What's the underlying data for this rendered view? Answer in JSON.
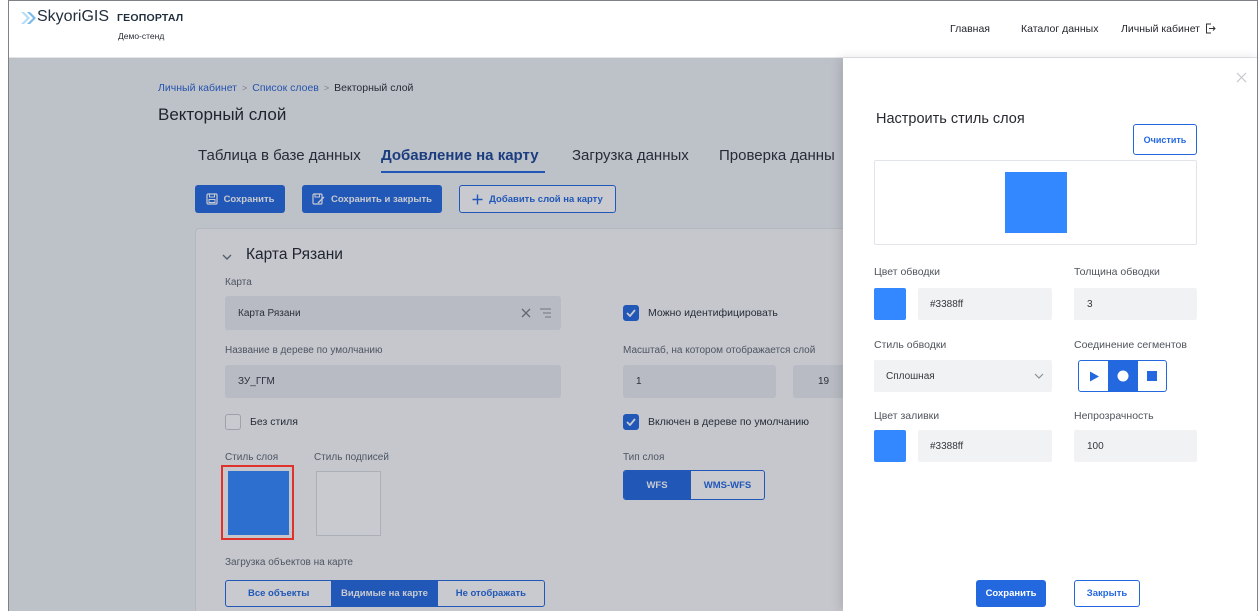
{
  "app": {
    "brand": "SkyoriGIS",
    "brand_suffix": "ГЕОПОРТАЛ",
    "subtitle": "Демо-стенд"
  },
  "nav": {
    "home": "Главная",
    "catalog": "Каталог данных",
    "account": "Личный кабинет"
  },
  "breadcrumb": {
    "items": [
      "Личный кабинет",
      "Список слоев",
      "Векторный слой"
    ],
    "separator": ">"
  },
  "page_title": "Векторный слой",
  "tabs": [
    {
      "label": "Таблица в базе данных",
      "active": false
    },
    {
      "label": "Добавление на карту",
      "active": true
    },
    {
      "label": "Загрузка данных",
      "active": false
    },
    {
      "label": "Проверка данны",
      "active": false
    }
  ],
  "toolbar": {
    "save": "Сохранить",
    "save_close": "Сохранить и закрыть",
    "add_to_map": "Добавить слой на карту"
  },
  "map_card": {
    "title": "Карта Рязани",
    "map": {
      "label": "Карта",
      "value": "Карта Рязани"
    },
    "identifiable": {
      "label": "Можно идентифицировать",
      "checked": true
    },
    "tree_name": {
      "label": "Название в дереве по умолчанию",
      "value": "ЗУ_ГГМ"
    },
    "scale": {
      "label": "Масштаб, на котором отображается слой",
      "min": "1",
      "max": "19"
    },
    "no_style": {
      "label": "Без стиля",
      "checked": false
    },
    "enabled_in_tree": {
      "label": "Включен в дереве по умолчанию",
      "checked": true
    },
    "layer_style": {
      "label": "Стиль слоя",
      "color": "#3388ff"
    },
    "label_style": {
      "label": "Стиль подписей"
    },
    "layer_type": {
      "label": "Тип слоя",
      "options": [
        "WFS",
        "WMS-WFS"
      ],
      "selected": "WFS"
    },
    "object_loading": {
      "label": "Загрузка объектов на карте",
      "options": [
        "Все объекты",
        "Видимые на карте",
        "Не отображать"
      ],
      "selected": "Видимые на карте"
    }
  },
  "style_drawer": {
    "title": "Настроить стиль слоя",
    "clear": "Очистить",
    "preview_fill": "#3388ff",
    "stroke_color": {
      "label": "Цвет обводки",
      "value": "#3388ff"
    },
    "stroke_width": {
      "label": "Толщина обводки",
      "value": "3"
    },
    "stroke_style": {
      "label": "Стиль обводки",
      "value": "Сплошная"
    },
    "line_join": {
      "label": "Соединение сегментов",
      "options": [
        "triangle-icon",
        "circle-icon",
        "square-icon"
      ],
      "selected": "circle-icon"
    },
    "fill_color": {
      "label": "Цвет заливки",
      "value": "#3388ff"
    },
    "opacity": {
      "label": "Непрозрачность",
      "value": "100"
    },
    "save": "Сохранить",
    "close": "Закрыть"
  },
  "colors": {
    "accent": "#2468e0",
    "highlight": "#e0312b",
    "overlay": "rgba(25,35,55,0.24)"
  }
}
